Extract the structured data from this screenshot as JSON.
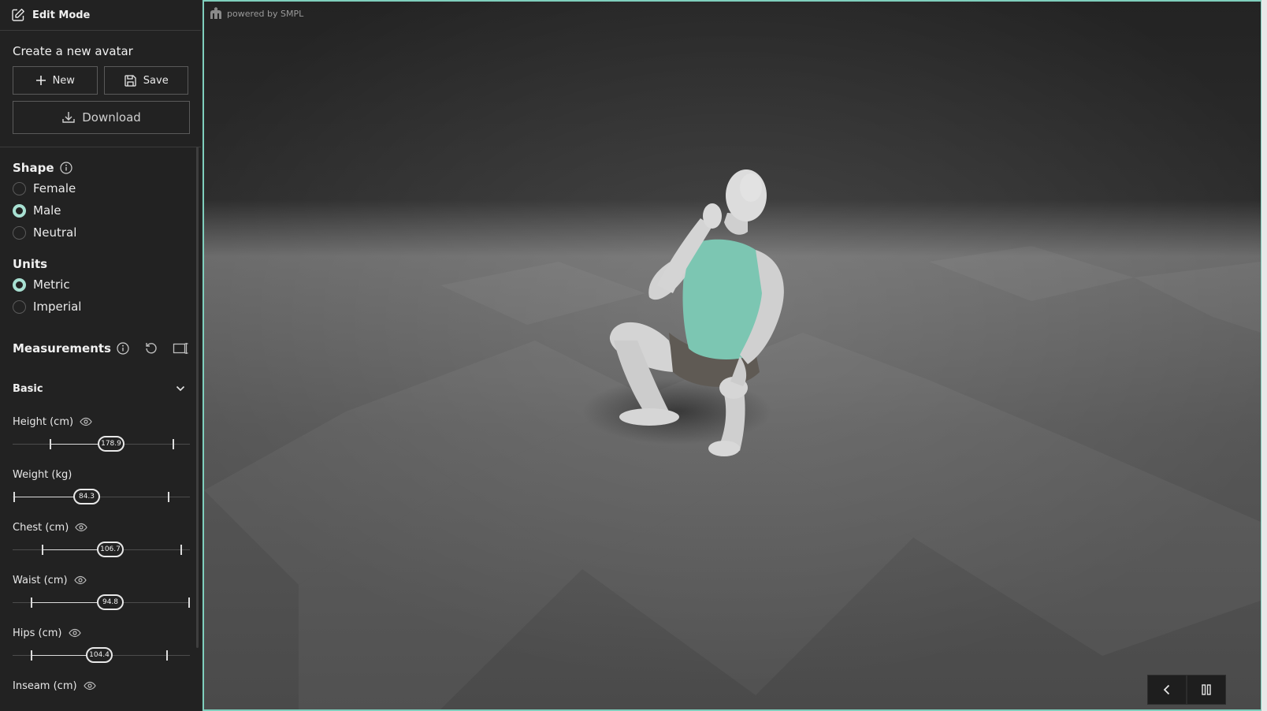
{
  "header": {
    "title": "Edit Mode"
  },
  "create": {
    "heading": "Create a new avatar",
    "new_label": "New",
    "save_label": "Save",
    "download_label": "Download"
  },
  "shape": {
    "heading": "Shape",
    "options": [
      {
        "label": "Female",
        "selected": false
      },
      {
        "label": "Male",
        "selected": true
      },
      {
        "label": "Neutral",
        "selected": false
      }
    ]
  },
  "units": {
    "heading": "Units",
    "options": [
      {
        "label": "Metric",
        "selected": true
      },
      {
        "label": "Imperial",
        "selected": false
      }
    ]
  },
  "measurements": {
    "heading": "Measurements",
    "group_label": "Basic",
    "sliders": [
      {
        "label": "Height (cm)",
        "value": "178.9",
        "visible_icon": true
      },
      {
        "label": "Weight (kg)",
        "value": "84.3",
        "visible_icon": false
      },
      {
        "label": "Chest (cm)",
        "value": "106.7",
        "visible_icon": true
      },
      {
        "label": "Waist (cm)",
        "value": "94.8",
        "visible_icon": true
      },
      {
        "label": "Hips (cm)",
        "value": "104.4",
        "visible_icon": true
      },
      {
        "label": "Inseam (cm)",
        "value": "",
        "visible_icon": true
      }
    ]
  },
  "viewport": {
    "powered_by": "powered by SMPL",
    "accent": "#7fcfbd",
    "controls": [
      "chevron-left-icon",
      "pause-icon"
    ]
  }
}
